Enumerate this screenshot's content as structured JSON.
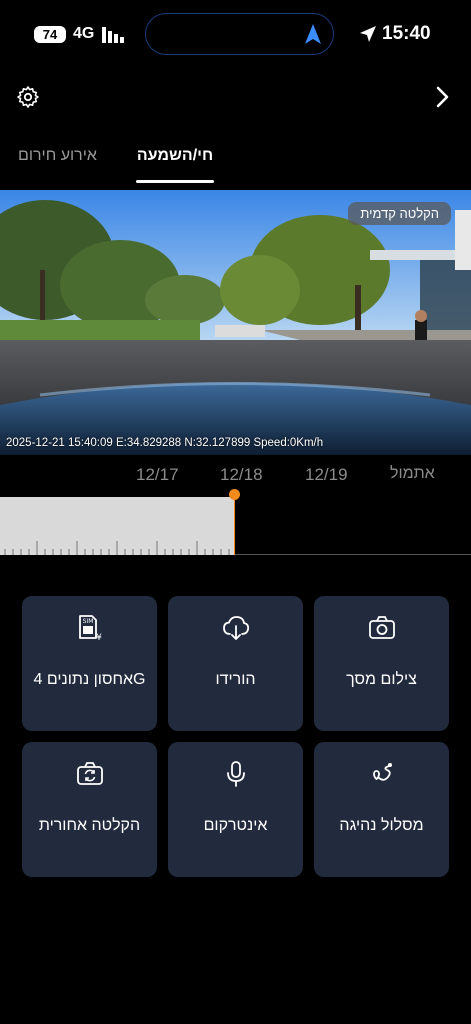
{
  "status": {
    "battery": "74",
    "network": "4G",
    "time": "15:40"
  },
  "tabs": [
    {
      "label": "חי/השמעה",
      "active": true
    },
    {
      "label": "אירוע חירום",
      "active": false
    }
  ],
  "video": {
    "badge": "הקלטה קדמית",
    "overlay": "2025-12-21 15:40:09 E:34.829288 N:32.127899 Speed:0Km/h"
  },
  "timeline": {
    "dates": [
      "12/17",
      "12/18",
      "12/19"
    ],
    "yesterday_label": "אתמול"
  },
  "actions": [
    {
      "label": "צילום מסך",
      "icon": "camera-icon"
    },
    {
      "label": "הורידו",
      "icon": "cloud-download-icon"
    },
    {
      "label": "אחסון נתונים 4G",
      "icon": "sim-card-icon"
    },
    {
      "label": "מסלול נהיגה",
      "icon": "route-icon"
    },
    {
      "label": "אינטרקום",
      "icon": "microphone-icon"
    },
    {
      "label": "הקלטה אחורית",
      "icon": "camera-switch-icon"
    }
  ],
  "colors": {
    "accent": "#f28a1c",
    "tile": "#222b3e",
    "nav_arrow": "#3a8cff"
  }
}
